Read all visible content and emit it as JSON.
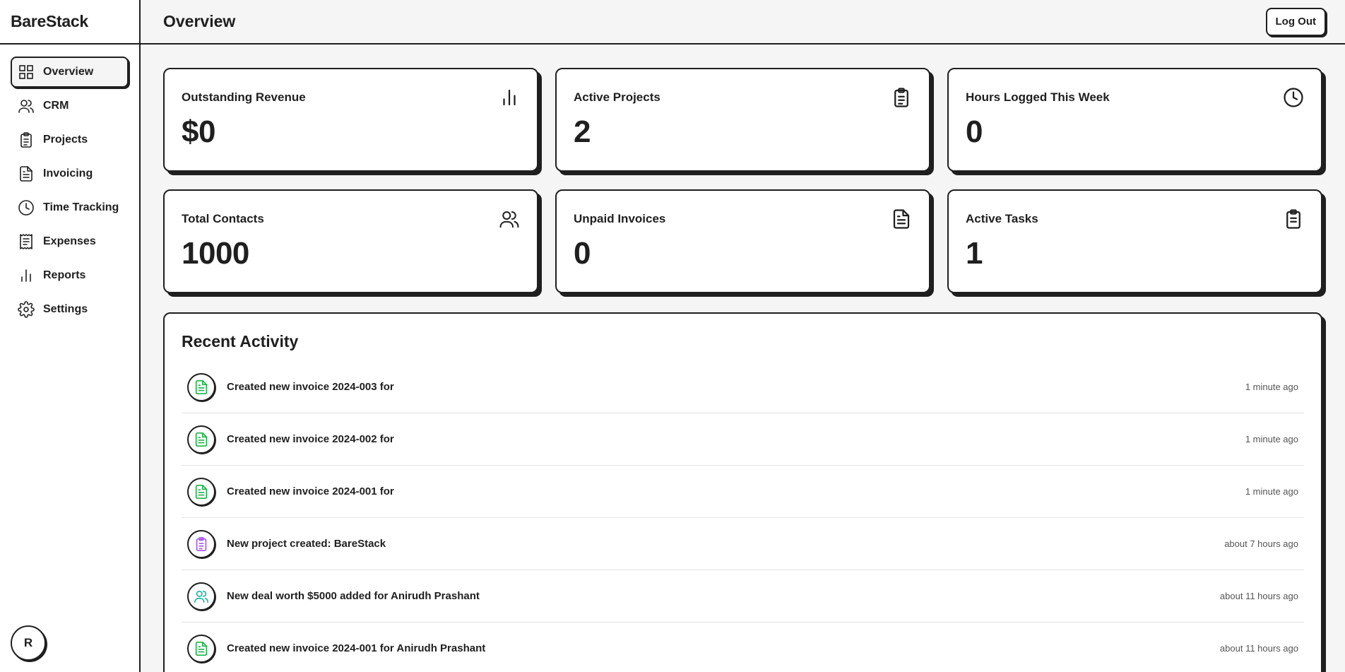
{
  "brand": "BareStack",
  "page_title": "Overview",
  "logout_label": "Log Out",
  "avatar_initial": "R",
  "sidebar": {
    "items": [
      {
        "label": "Overview",
        "icon": "grid-icon"
      },
      {
        "label": "CRM",
        "icon": "users-icon"
      },
      {
        "label": "Projects",
        "icon": "clipboard-icon"
      },
      {
        "label": "Invoicing",
        "icon": "file-text-icon"
      },
      {
        "label": "Time Tracking",
        "icon": "clock-icon"
      },
      {
        "label": "Expenses",
        "icon": "receipt-icon"
      },
      {
        "label": "Reports",
        "icon": "bar-chart-icon"
      },
      {
        "label": "Settings",
        "icon": "gear-icon"
      }
    ]
  },
  "stats": [
    {
      "label": "Outstanding Revenue",
      "value": "$0",
      "icon": "bar-chart-icon"
    },
    {
      "label": "Active Projects",
      "value": "2",
      "icon": "clipboard-icon"
    },
    {
      "label": "Hours Logged This Week",
      "value": "0",
      "icon": "clock-icon"
    },
    {
      "label": "Total Contacts",
      "value": "1000",
      "icon": "users-icon"
    },
    {
      "label": "Unpaid Invoices",
      "value": "0",
      "icon": "file-text-icon"
    },
    {
      "label": "Active Tasks",
      "value": "1",
      "icon": "clipboard-icon"
    }
  ],
  "activity": {
    "title": "Recent Activity",
    "items": [
      {
        "text": "Created new invoice 2024-003 for",
        "time": "1 minute ago",
        "icon": "file-text-icon",
        "color": "#22b14c"
      },
      {
        "text": "Created new invoice 2024-002 for",
        "time": "1 minute ago",
        "icon": "file-text-icon",
        "color": "#22b14c"
      },
      {
        "text": "Created new invoice 2024-001 for",
        "time": "1 minute ago",
        "icon": "file-text-icon",
        "color": "#22b14c"
      },
      {
        "text": "New project created: BareStack",
        "time": "about 7 hours ago",
        "icon": "clipboard-icon",
        "color": "#a855f7"
      },
      {
        "text": "New deal worth $5000 added for Anirudh Prashant",
        "time": "about 11 hours ago",
        "icon": "users-icon",
        "color": "#14b8a6"
      },
      {
        "text": "Created new invoice 2024-001 for Anirudh Prashant",
        "time": "about 11 hours ago",
        "icon": "file-text-icon",
        "color": "#22b14c"
      }
    ]
  },
  "colors": {
    "ink": "#1f1f1f",
    "background": "#f5f5f5",
    "invoice": "#22b14c",
    "project": "#a855f7",
    "deal": "#14b8a6"
  }
}
